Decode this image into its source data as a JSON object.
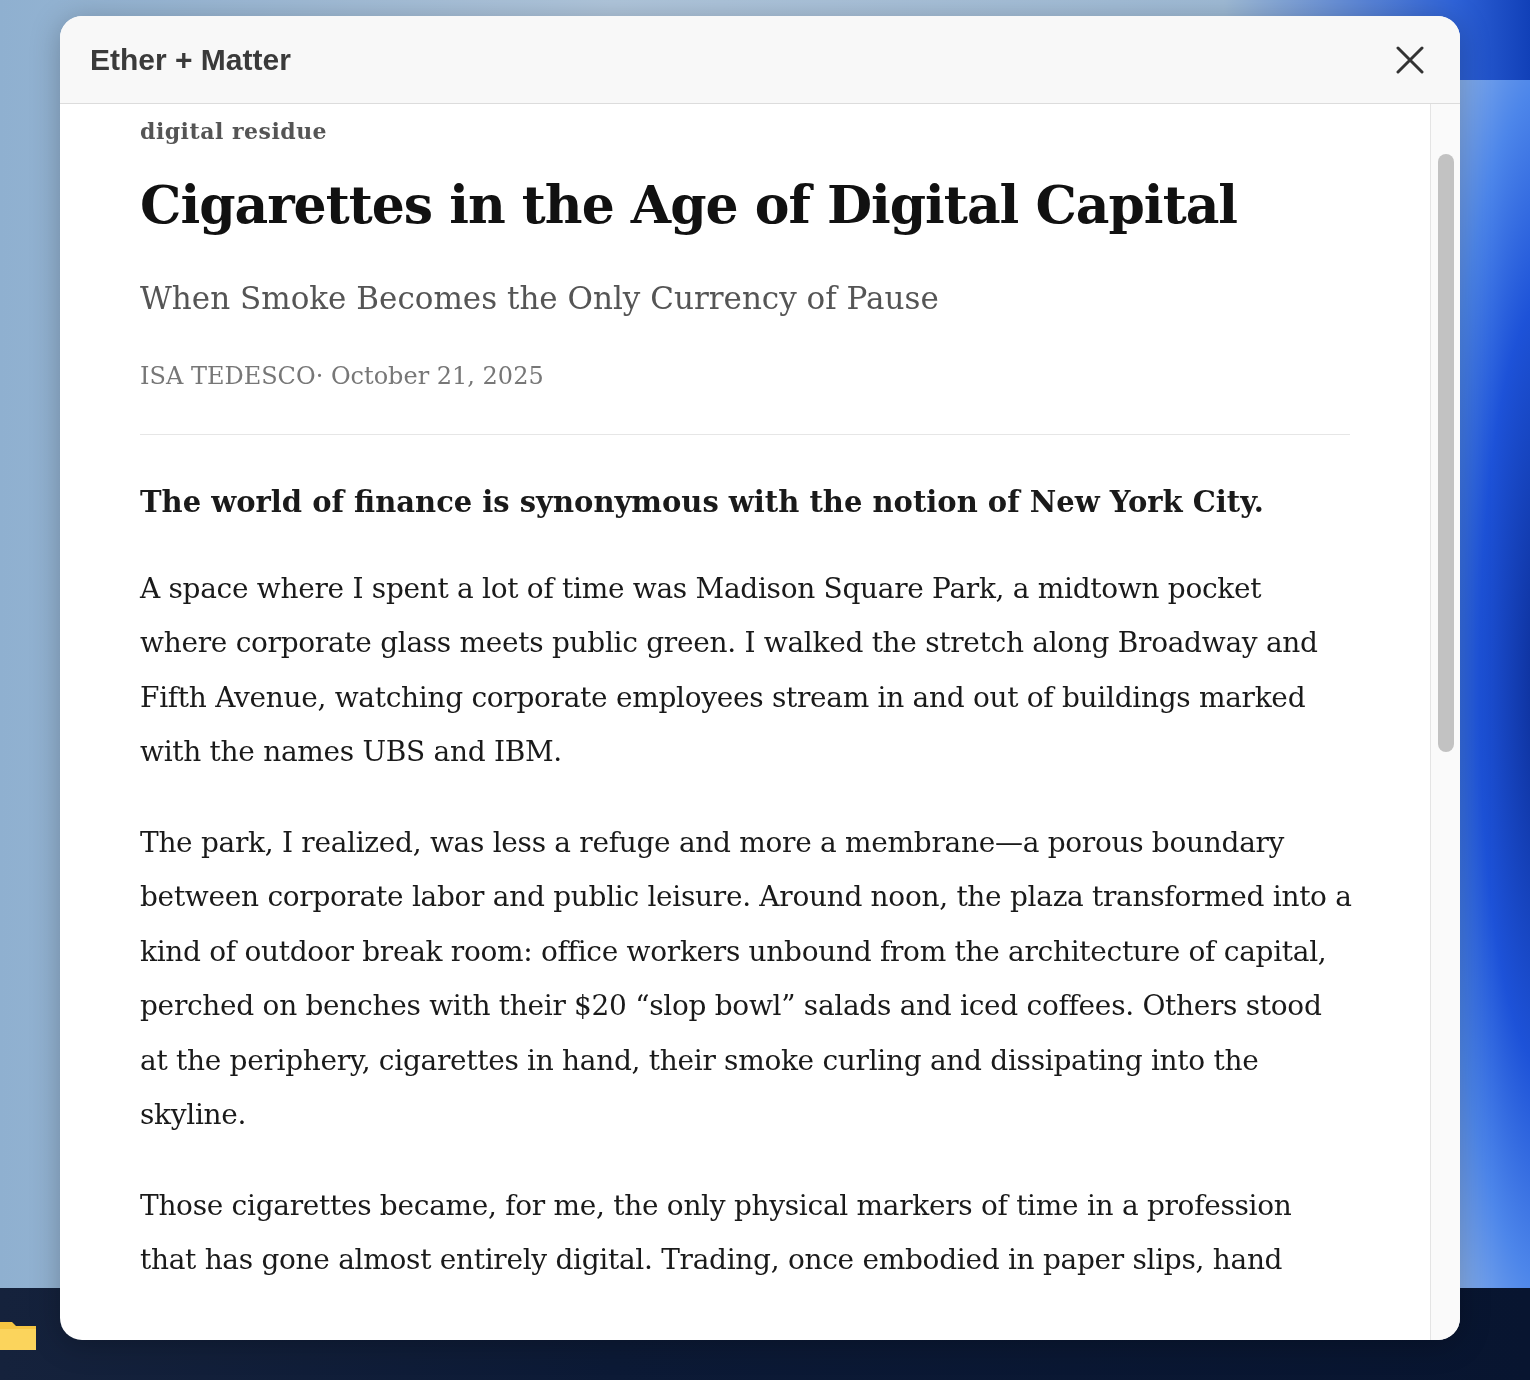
{
  "window": {
    "title": "Ether + Matter"
  },
  "article": {
    "kicker": "digital residue",
    "title": "Cigarettes in the Age of Digital Capital",
    "subtitle": "When Smoke Becomes the Only Currency of Pause",
    "byline": "ISA TEDESCO· October 21, 2025",
    "lead": "The world of finance is synonymous with the notion of New York City.",
    "paragraphs": [
      "A space where I spent a lot of time was Madison Square Park, a midtown pocket where corporate glass meets public green. I walked the stretch along Broadway and Fifth Avenue, watching corporate employees stream in and out of buildings marked with the names UBS and IBM.",
      "The park, I realized, was less a refuge and more a membrane—a porous boundary between corporate labor and public leisure. Around noon, the plaza transformed into a kind of outdoor break room: office workers unbound from the architecture of capital, perched on benches with their $20 “slop bowl” salads and iced coffees. Others stood at the periphery, cigarettes in hand, their smoke curling and dissipating into the skyline.",
      "Those cigarettes became, for me, the only physical markers of time in a profession that has gone almost entirely digital. Trading, once embodied in paper slips, hand"
    ]
  }
}
